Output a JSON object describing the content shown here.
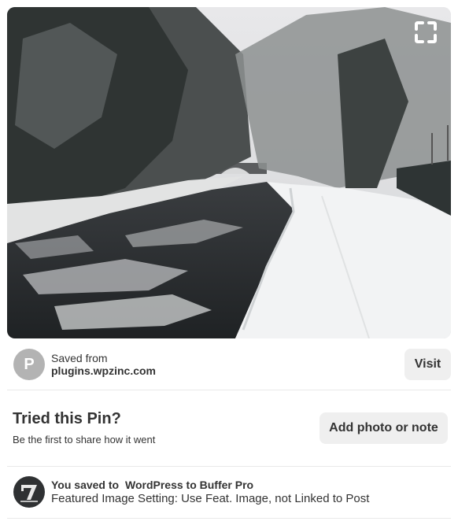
{
  "pin": {
    "image_alt": "Snow-covered canal towpath with icy water and snowy trees",
    "expand_icon": "expand-icon"
  },
  "source": {
    "avatar_letter": "P",
    "saved_from_label": "Saved from",
    "domain": "plugins.wpzinc.com",
    "visit_label": "Visit"
  },
  "tried": {
    "title": "Tried this Pin?",
    "subtitle": "Be the first to share how it went",
    "add_label": "Add photo or note"
  },
  "activity": {
    "prefix": "You saved to",
    "board": "WordPress to Buffer Pro",
    "description": "Featured Image Setting: Use Feat. Image, not Linked to Post"
  },
  "colors": {
    "button_bg": "#efefef",
    "avatar_bg": "#b3b3b3",
    "text": "#333333"
  }
}
